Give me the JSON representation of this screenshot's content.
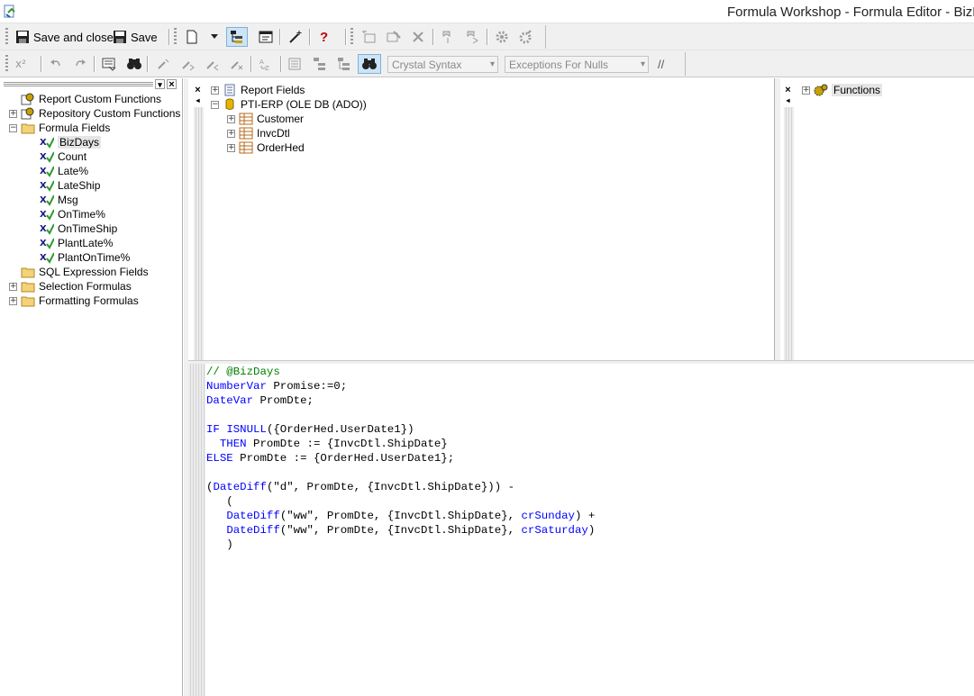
{
  "window": {
    "title": "Formula Workshop - Formula Editor - BizD"
  },
  "toolbar": {
    "save_and_close_label": "Save and close",
    "save_label": "Save",
    "syntax_select": "Crystal Syntax",
    "nulls_select": "Exceptions For Nulls",
    "comment_label": "//"
  },
  "workshop_tree": {
    "items": [
      {
        "label": "Report Custom Functions"
      },
      {
        "label": "Repository Custom Functions"
      },
      {
        "label": "Formula Fields"
      },
      {
        "label": "BizDays"
      },
      {
        "label": "Count"
      },
      {
        "label": "Late%"
      },
      {
        "label": "LateShip"
      },
      {
        "label": "Msg"
      },
      {
        "label": "OnTime%"
      },
      {
        "label": "OnTimeShip"
      },
      {
        "label": "PlantLate%"
      },
      {
        "label": "PlantOnTime%"
      },
      {
        "label": "SQL Expression Fields"
      },
      {
        "label": "Selection Formulas"
      },
      {
        "label": "Formatting Formulas"
      }
    ]
  },
  "fields_tree": {
    "items": [
      {
        "label": "Report Fields"
      },
      {
        "label": "PTI-ERP (OLE DB (ADO))"
      },
      {
        "label": "Customer"
      },
      {
        "label": "InvcDtl"
      },
      {
        "label": "OrderHed"
      }
    ]
  },
  "functions_tree": {
    "items": [
      {
        "label": "Functions"
      }
    ]
  },
  "editor": {
    "lines": [
      [
        {
          "t": "// @BizDays",
          "c": "cm"
        }
      ],
      [
        {
          "t": "NumberVar",
          "c": "kw"
        },
        {
          "t": " Promise:=0;",
          "c": ""
        }
      ],
      [
        {
          "t": "DateVar",
          "c": "kw"
        },
        {
          "t": " PromDte;",
          "c": ""
        }
      ],
      [
        {
          "t": "",
          "c": ""
        }
      ],
      [
        {
          "t": "IF",
          "c": "kw"
        },
        {
          "t": " ",
          "c": ""
        },
        {
          "t": "ISNULL",
          "c": "kw"
        },
        {
          "t": "({OrderHed.UserDate1})",
          "c": ""
        }
      ],
      [
        {
          "t": "  ",
          "c": ""
        },
        {
          "t": "THEN",
          "c": "kw"
        },
        {
          "t": " PromDte := {InvcDtl.ShipDate}",
          "c": ""
        }
      ],
      [
        {
          "t": "ELSE",
          "c": "kw"
        },
        {
          "t": " PromDte := {OrderHed.UserDate1};",
          "c": ""
        }
      ],
      [
        {
          "t": "",
          "c": ""
        }
      ],
      [
        {
          "t": "(",
          "c": ""
        },
        {
          "t": "DateDiff",
          "c": "fn"
        },
        {
          "t": "(\"d\", PromDte, {InvcDtl.ShipDate})) -",
          "c": ""
        }
      ],
      [
        {
          "t": "   (",
          "c": ""
        }
      ],
      [
        {
          "t": "   ",
          "c": ""
        },
        {
          "t": "DateDiff",
          "c": "fn"
        },
        {
          "t": "(\"ww\", PromDte, {InvcDtl.ShipDate}, ",
          "c": ""
        },
        {
          "t": "crSunday",
          "c": "kw"
        },
        {
          "t": ") +",
          "c": ""
        }
      ],
      [
        {
          "t": "   ",
          "c": ""
        },
        {
          "t": "DateDiff",
          "c": "fn"
        },
        {
          "t": "(\"ww\", PromDte, {InvcDtl.ShipDate}, ",
          "c": ""
        },
        {
          "t": "crSaturday",
          "c": "kw"
        },
        {
          "t": ")",
          "c": ""
        }
      ],
      [
        {
          "t": "   )",
          "c": ""
        }
      ]
    ]
  }
}
